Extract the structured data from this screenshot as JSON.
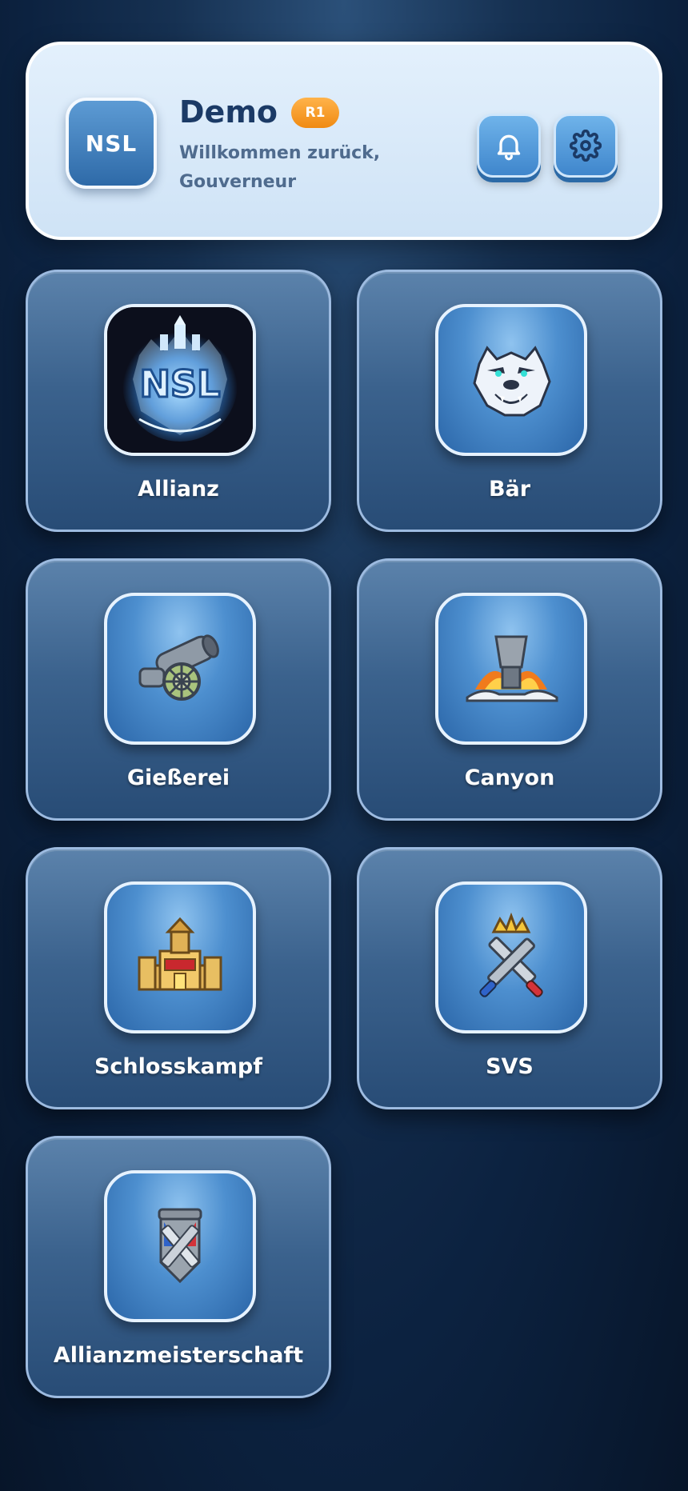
{
  "header": {
    "avatar_text": "NSL",
    "user_name": "Demo",
    "rank_badge": "R1",
    "welcome_text": "Willkommen zurück, Gouverneur"
  },
  "tiles": [
    {
      "label": "Allianz",
      "icon": "nsl-logo-icon"
    },
    {
      "label": "Bär",
      "icon": "polar-bear-icon"
    },
    {
      "label": "Gießerei",
      "icon": "cannon-icon"
    },
    {
      "label": "Canyon",
      "icon": "volcano-forge-icon"
    },
    {
      "label": "Schlosskampf",
      "icon": "castle-icon"
    },
    {
      "label": "SVS",
      "icon": "crossed-swords-crown-icon"
    },
    {
      "label": "Allianzmeisterschaft",
      "icon": "shield-banner-icon"
    }
  ],
  "colors": {
    "background": "#0c2240",
    "header_bg": "#d9eaf9",
    "accent_blue": "#3f86cc",
    "rank_orange": "#f59a1f",
    "title_text": "#1b3a66"
  }
}
